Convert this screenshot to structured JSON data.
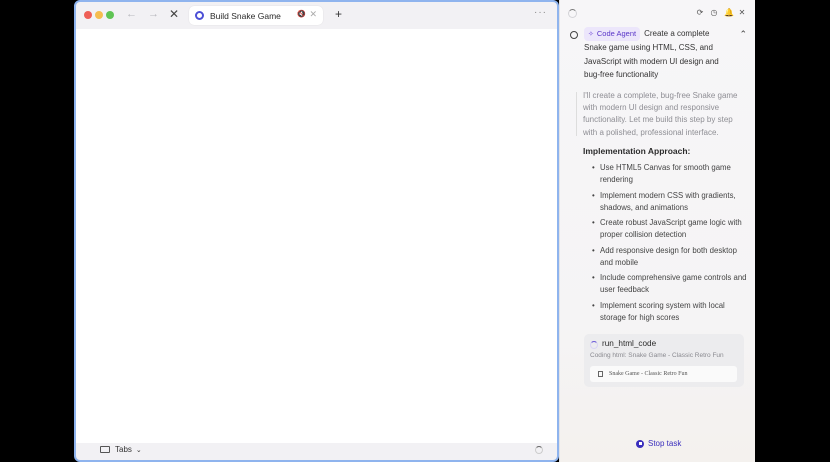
{
  "browser": {
    "nav": {
      "back": "←",
      "forward": "→",
      "stop": "✕"
    },
    "tab": {
      "title": "Build Snake Game",
      "mute": "🔇",
      "close": "✕"
    },
    "new_tab": "+",
    "more": "···",
    "bottom": {
      "tabs_label": "Tabs",
      "chevron": "⌄"
    }
  },
  "panel": {
    "header_icons": [
      "⟳",
      "◷",
      "🔔",
      "✕"
    ],
    "task": {
      "badge": "Code Agent",
      "badge_icon": "✧",
      "prompt": "Create a complete Snake game using HTML, CSS, and JavaScript with modern UI design and bug-free functionality",
      "collapse": "⌃"
    },
    "response": "I'll create a complete, bug-free Snake game with modern UI design and responsive functionality. Let me build this step by step with a polished, professional interface.",
    "approach_title": "Implementation Approach:",
    "approach_items": [
      "Use HTML5 Canvas for smooth game rendering",
      "Implement modern CSS with gradients, shadows, and animations",
      "Create robust JavaScript game logic with proper collision detection",
      "Add responsive design for both desktop and mobile",
      "Include comprehensive game controls and user feedback",
      "Implement scoring system with local storage for high scores"
    ],
    "tool": {
      "name": "run_html_code",
      "description": "Coding html: Snake Game - Classic Retro Fun",
      "file": "Snake Game - Classic Retro Fun"
    },
    "stop_label": "Stop task"
  }
}
